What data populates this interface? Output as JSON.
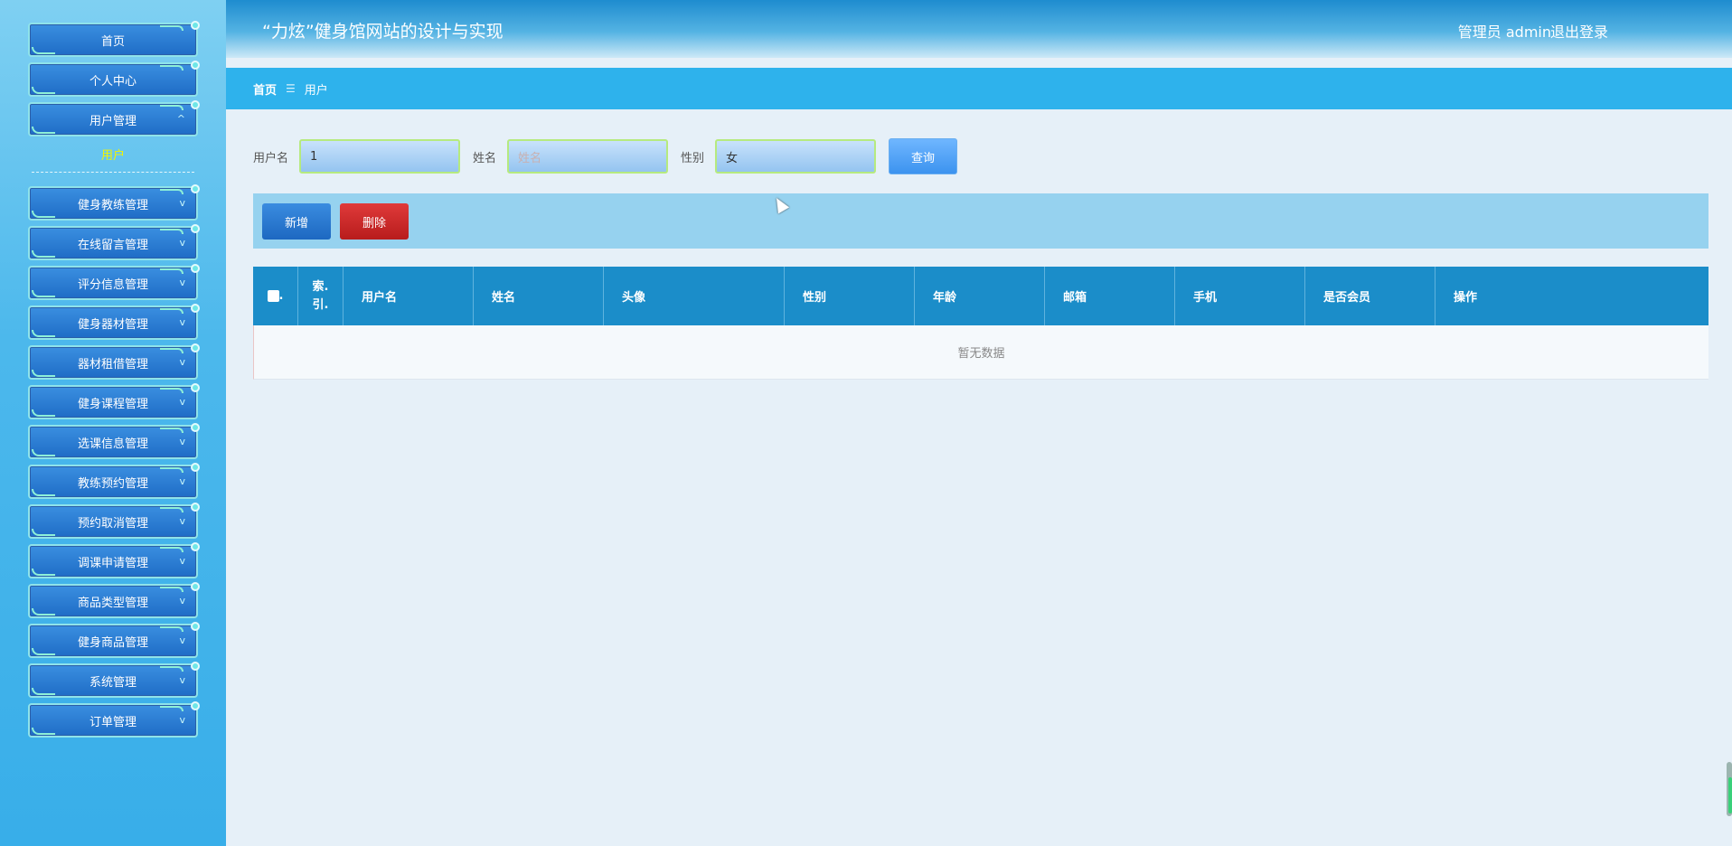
{
  "header": {
    "title": "“力炫”健身馆网站的设计与实现",
    "user_label": "管理员 admin",
    "logout_label": "退出登录"
  },
  "sidebar": {
    "top_items": [
      {
        "label": "首页"
      },
      {
        "label": "个人中心"
      },
      {
        "label": "用户管理"
      }
    ],
    "submenu_active": "用户",
    "items": [
      {
        "label": "健身教练管理"
      },
      {
        "label": "在线留言管理"
      },
      {
        "label": "评分信息管理"
      },
      {
        "label": "健身器材管理"
      },
      {
        "label": "器材租借管理"
      },
      {
        "label": "健身课程管理"
      },
      {
        "label": "选课信息管理"
      },
      {
        "label": "教练预约管理"
      },
      {
        "label": "预约取消管理"
      },
      {
        "label": "调课申请管理"
      },
      {
        "label": "商品类型管理"
      },
      {
        "label": "健身商品管理"
      },
      {
        "label": "系统管理"
      },
      {
        "label": "订单管理"
      }
    ]
  },
  "breadcrumb": {
    "home": "首页",
    "separator": "☰",
    "current": "用户"
  },
  "search": {
    "username_label": "用户名",
    "username_value": "1",
    "name_label": "姓名",
    "name_placeholder": "姓名",
    "gender_label": "性别",
    "gender_value": "女",
    "search_button": "查询"
  },
  "actions": {
    "add_button": "新增",
    "delete_button": "删除"
  },
  "table": {
    "columns": [
      "索引",
      "用户名",
      "姓名",
      "头像",
      "性别",
      "年龄",
      "邮箱",
      "手机",
      "是否会员",
      "操作"
    ],
    "index_header_line1": "索.",
    "index_header_line2": "引.",
    "empty_text": "暂无数据"
  },
  "colors": {
    "header_blue": "#1e8ccf",
    "breadcrumb_blue": "#2eb2ec",
    "table_header": "#1b8dc9",
    "delete_red": "#d32a2a",
    "submenu_active_yellow": "#f3f500"
  }
}
